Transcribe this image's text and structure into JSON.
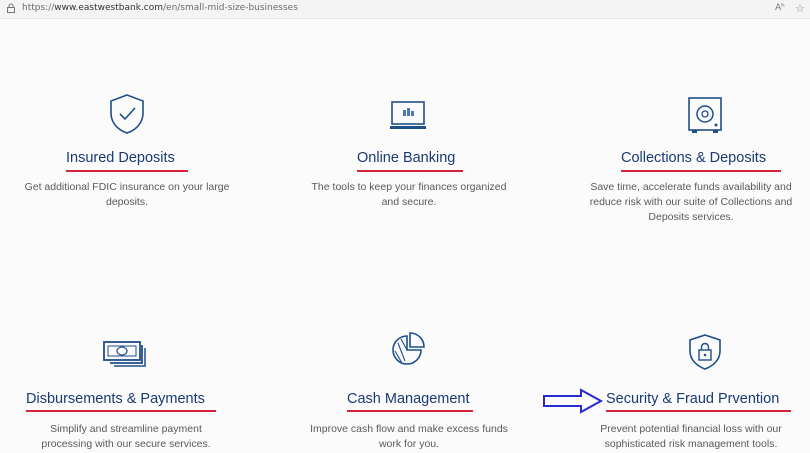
{
  "browser": {
    "url_prefix": "https://",
    "url_domain": "www.eastwestbank.com",
    "url_path": "/en/small-mid-size-businesses",
    "read_aloud": "Aʰ"
  },
  "cards": [
    {
      "title": "Insured Deposits",
      "desc1": "Get additional FDIC insurance on your large",
      "desc2": "deposits.",
      "desc3": ""
    },
    {
      "title": "Online Banking",
      "desc1": "The tools to keep your finances organized",
      "desc2": "and secure.",
      "desc3": ""
    },
    {
      "title": "Collections & Deposits",
      "desc1": "Save time, accelerate funds availability and",
      "desc2": "reduce risk with our suite of Collections and",
      "desc3": "Deposits services."
    },
    {
      "title": "Disbursements & Payments",
      "desc1": "Simplify and streamline payment",
      "desc2": "processing with our secure services.",
      "desc3": ""
    },
    {
      "title": "Cash Management",
      "desc1": "Improve cash flow and make excess funds",
      "desc2": "work for you.",
      "desc3": ""
    },
    {
      "title": "Security & Fraud Prvention",
      "desc1": "Prevent potential financial loss with our",
      "desc2": "sophisticated risk management tools.",
      "desc3": ""
    }
  ],
  "colors": {
    "title": "#1a3a72",
    "underline": "#d6233c",
    "icon": "#1f4e8c",
    "arrow": "#2a2ad0"
  },
  "icons": [
    "shield-check-icon",
    "laptop-icon",
    "safe-icon",
    "cash-icon",
    "pie-chart-icon",
    "shield-lock-icon",
    "arrow-right-icon"
  ]
}
